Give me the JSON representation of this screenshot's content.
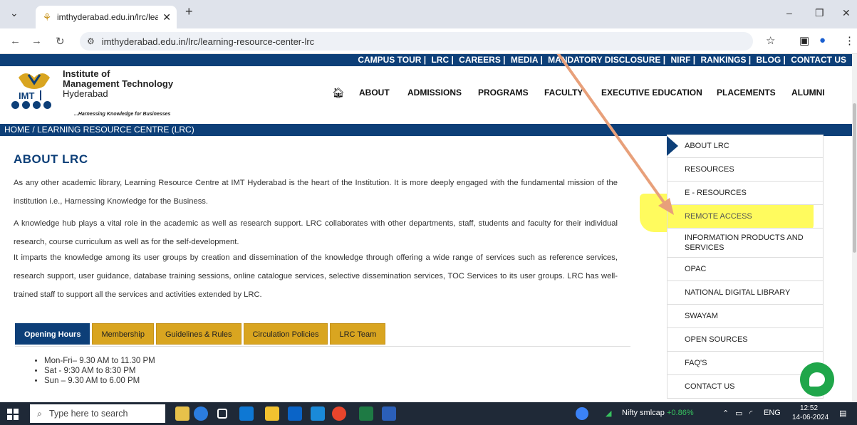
{
  "browser": {
    "tab_title": "imthyderabad.edu.in/lrc/learnin",
    "url": "imthyderabad.edu.in/lrc/learning-resource-center-lrc"
  },
  "topnav": [
    "CAMPUS TOUR |",
    "LRC |",
    "CAREERS |",
    "MEDIA |",
    "MANDATORY DISCLOSURE |",
    "NIRF |",
    "RANKINGS |",
    "BLOG |",
    "CONTACT US"
  ],
  "logo": {
    "abbr": "IMT",
    "line1": "Institute of",
    "line2": "Management Technology",
    "line3": "Hyderabad",
    "tagline": "...Harnessing Knowledge for Businesses"
  },
  "mainnav": [
    "ABOUT",
    "ADMISSIONS",
    "PROGRAMS",
    "FACULTY",
    "EXECUTIVE EDUCATION",
    "PLACEMENTS",
    "ALUMNI"
  ],
  "breadcrumb": "HOME / LEARNING RESOURCE CENTRE (LRC)",
  "content": {
    "title": "ABOUT LRC",
    "p1": "As any other academic library, Learning Resource Centre at IMT Hyderabad is the heart of the Institution. It is more deeply engaged with the fundamental mission of the institution i.e., Harnessing Knowledge for the Business.",
    "p2": "A knowledge hub plays a vital role in the academic as well as research support. LRC collaborates with other departments, staff, students and faculty for their individual research, course curriculum as well as for the self-development.",
    "p3": "It imparts the knowledge among its user groups by creation and dissemination of the knowledge through offering a wide range of services such as reference services, research support, user guidance, database training sessions, online catalogue services, selective dissemination services, TOC Services to its user groups. LRC has well-trained staff to support all the services and activities extended by LRC."
  },
  "tabs": [
    "Opening Hours",
    "Membership",
    "Guidelines & Rules",
    "Circulation Policies",
    "LRC Team"
  ],
  "hours": [
    "Mon-Fri– 9.30 AM to 11.30 PM",
    "Sat - 9:30 AM to 8:30 PM",
    "Sun – 9.30 AM to 6.00 PM"
  ],
  "sidebar": [
    "ABOUT LRC",
    "RESOURCES",
    "E - RESOURCES",
    "REMOTE ACCESS",
    "INFORMATION PRODUCTS AND SERVICES",
    "OPAC",
    "NATIONAL DIGITAL LIBRARY",
    "SWAYAM",
    "OPEN SOURCES",
    "FAQ'S",
    "CONTACT US"
  ],
  "taskbar": {
    "search_placeholder": "Type here to search",
    "stock_name": "Nifty smlcap",
    "stock_change": "+0.86%",
    "lang": "ENG",
    "time": "12:52",
    "date": "14-06-2024"
  },
  "colors": {
    "brand_navy": "#0d3f78",
    "tab_gold": "#d9a520",
    "highlight": "#fffa28",
    "chat_green": "#1fa64a"
  }
}
